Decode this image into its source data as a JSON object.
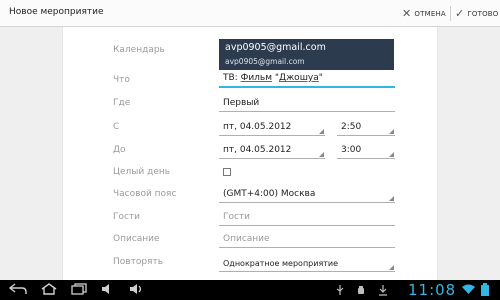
{
  "actionbar": {
    "title": "Новое мероприятие",
    "cancel_label": "ОТМЕНА",
    "done_label": "ГОТОВО",
    "cancel_icon": "close-icon",
    "done_icon": "checkmark-icon"
  },
  "form": {
    "calendar": {
      "label": "Календарь",
      "account_name": "avp0905@gmail.com",
      "account_email": "avp0905@gmail.com"
    },
    "what": {
      "label": "Что",
      "value_prefix": "ТВ: ",
      "value_word1": "Фильм",
      "value_mid": " \"",
      "value_word2": "Джошуа",
      "value_suffix": "\""
    },
    "where": {
      "label": "Где",
      "value": "Первый"
    },
    "from": {
      "label": "С",
      "date": "пт, 04.05.2012",
      "time": "2:50"
    },
    "to": {
      "label": "До",
      "date": "пт, 04.05.2012",
      "time": "3:00"
    },
    "all_day": {
      "label": "Целый день",
      "checked": false
    },
    "timezone": {
      "label": "Часовой пояс",
      "value": "(GMT+4:00) Москва"
    },
    "guests": {
      "label": "Гости",
      "placeholder": "Гости"
    },
    "description": {
      "label": "Описание",
      "placeholder": "Описание"
    },
    "repeat": {
      "label": "Повторять",
      "value": "Однократное мероприятие"
    }
  },
  "system_bar": {
    "clock": "11:08",
    "colors": {
      "clock": "#33b5e5",
      "background": "#000000"
    }
  },
  "colors": {
    "accent": "#33b5e5",
    "calendar_box": "#2d3b4e"
  }
}
